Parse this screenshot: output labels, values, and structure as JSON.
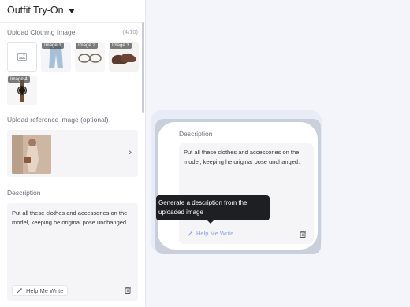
{
  "app": {
    "title": "Outfit Try-On"
  },
  "upload_clothing": {
    "label": "Upload Clothing Image",
    "count": "(4/10)",
    "images": [
      {
        "tag": "Image 1",
        "item": "jeans-icon"
      },
      {
        "tag": "Image 2",
        "item": "glasses-icon"
      },
      {
        "tag": "Image 3",
        "item": "shoes-icon"
      },
      {
        "tag": "Image 4",
        "item": "watch-icon"
      }
    ]
  },
  "upload_reference": {
    "label": "Upload reference image (optional)"
  },
  "description": {
    "label": "Description",
    "text": "Put all these clothes and accessories on the model, keeping he original pose unchanged.",
    "help_label": "Help Me Write"
  },
  "zoom_card": {
    "label": "Description",
    "text": "Put all these clothes and accessories on the model, keeping he original pose unchanged.",
    "help_label": "Help Me Write",
    "tooltip": "Generate a description from the uploaded image"
  },
  "colors": {
    "accent": "#8aa0e6",
    "tooltip_bg": "#1d1f23"
  }
}
